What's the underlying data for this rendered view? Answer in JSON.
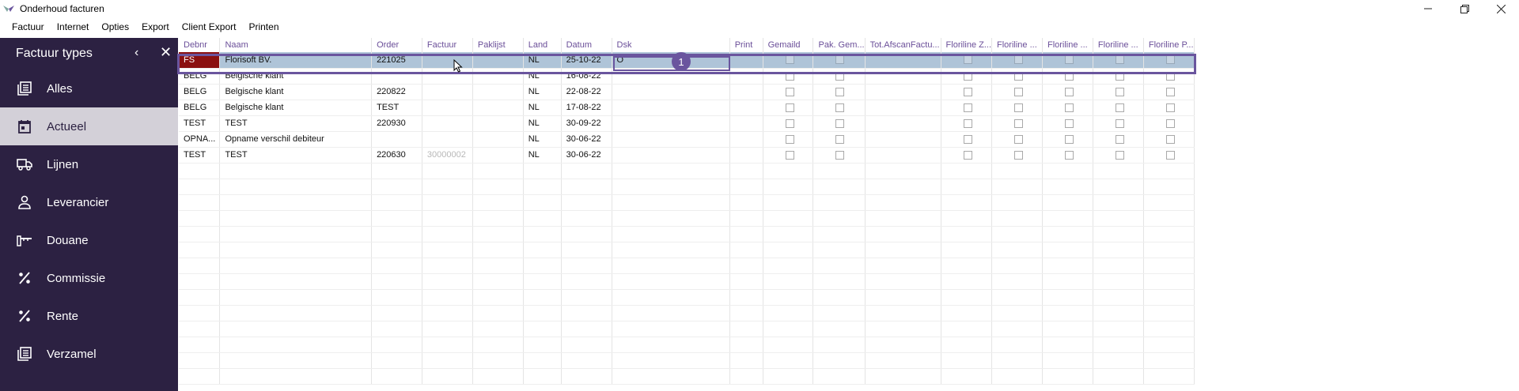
{
  "window": {
    "title": "Onderhoud facturen",
    "accent": "#6a559e",
    "sidebar_bg": "#2c2142",
    "selected_row_bg": "#afc4d8",
    "flag_bg": "#8b1010"
  },
  "menu": [
    "Factuur",
    "Internet",
    "Opties",
    "Export",
    "Client Export",
    "Printen"
  ],
  "sidebar": {
    "title": "Factuur types",
    "items": [
      {
        "label": "Alles",
        "icon": "list-icon"
      },
      {
        "label": "Actueel",
        "icon": "calendar-icon",
        "active": true
      },
      {
        "label": "Lijnen",
        "icon": "truck-icon"
      },
      {
        "label": "Leverancier",
        "icon": "person-icon"
      },
      {
        "label": "Douane",
        "icon": "barrier-icon"
      },
      {
        "label": "Commissie",
        "icon": "percent-icon"
      },
      {
        "label": "Rente",
        "icon": "percent-icon"
      },
      {
        "label": "Verzamel",
        "icon": "list-icon"
      }
    ]
  },
  "grid": {
    "columns": [
      "Debnr",
      "Naam",
      "Order",
      "Factuur",
      "Paklijst",
      "Land",
      "Datum",
      "Dsk",
      "Print",
      "Gemaild",
      "Pak. Gem...",
      "Tot.AfscanFactu...",
      "Floriline Z...",
      "Floriline ...",
      "Floriline ...",
      "Floriline ...",
      "Floriline P..."
    ],
    "rows": [
      {
        "debnr": "FS",
        "naam": "Florisoft BV.",
        "order": "221025",
        "factuur": "",
        "paklijst": "",
        "land": "NL",
        "datum": "25-10-22",
        "dsk": "O",
        "selected": true
      },
      {
        "debnr": "BELG",
        "naam": "Belgische klant",
        "order": "",
        "factuur": "",
        "paklijst": "",
        "land": "NL",
        "datum": "16-08-22",
        "dsk": ""
      },
      {
        "debnr": "BELG",
        "naam": "Belgische klant",
        "order": "220822",
        "factuur": "",
        "paklijst": "",
        "land": "NL",
        "datum": "22-08-22",
        "dsk": ""
      },
      {
        "debnr": "BELG",
        "naam": "Belgische klant",
        "order": "TEST",
        "factuur": "",
        "paklijst": "",
        "land": "NL",
        "datum": "17-08-22",
        "dsk": ""
      },
      {
        "debnr": "TEST",
        "naam": "TEST",
        "order": "220930",
        "factuur": "",
        "paklijst": "",
        "land": "NL",
        "datum": "30-09-22",
        "dsk": ""
      },
      {
        "debnr": "OPNA...",
        "naam": "Opname verschil debiteur",
        "order": "",
        "factuur": "",
        "paklijst": "",
        "land": "NL",
        "datum": "30-06-22",
        "dsk": ""
      },
      {
        "debnr": "TEST",
        "naam": "TEST",
        "order": "220630",
        "factuur": "30000002",
        "paklijst": "",
        "land": "NL",
        "datum": "30-06-22",
        "dsk": ""
      }
    ],
    "empty_rows": 14
  },
  "annotation": {
    "badge": "1"
  }
}
